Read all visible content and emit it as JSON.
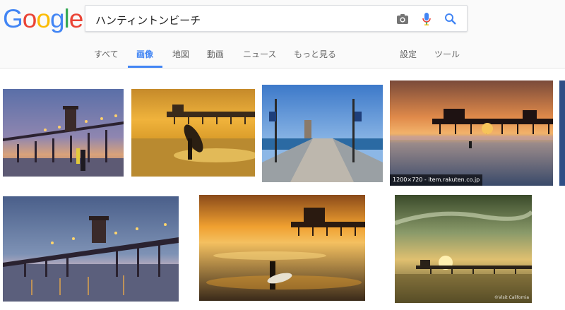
{
  "logo": {
    "letters": [
      {
        "char": "G",
        "color": "#4285f4"
      },
      {
        "char": "o",
        "color": "#ea4335"
      },
      {
        "char": "o",
        "color": "#fbbc05"
      },
      {
        "char": "g",
        "color": "#4285f4"
      },
      {
        "char": "l",
        "color": "#34a853"
      },
      {
        "char": "e",
        "color": "#ea4335"
      }
    ]
  },
  "search": {
    "query": "ハンティントンビーチ",
    "icons": [
      "camera-icon",
      "microphone-icon",
      "search-icon"
    ]
  },
  "tabs": [
    {
      "label": "すべて",
      "active": false
    },
    {
      "label": "画像",
      "active": true
    },
    {
      "label": "地図",
      "active": false
    },
    {
      "label": "動画",
      "active": false
    },
    {
      "label": "ニュース",
      "active": false
    },
    {
      "label": "もっと見る",
      "active": false
    },
    {
      "label": "設定",
      "active": false
    },
    {
      "label": "ツール",
      "active": false
    }
  ],
  "images": [
    {
      "caption": ""
    },
    {
      "caption": ""
    },
    {
      "caption": ""
    },
    {
      "caption": "1200×720 - item.rakuten.co.jp"
    },
    {
      "caption": ""
    },
    {
      "caption": ""
    },
    {
      "caption": "",
      "credit": "©Visit California"
    }
  ],
  "colors": {
    "accent": "#4285f4",
    "tab_text": "#666666"
  }
}
